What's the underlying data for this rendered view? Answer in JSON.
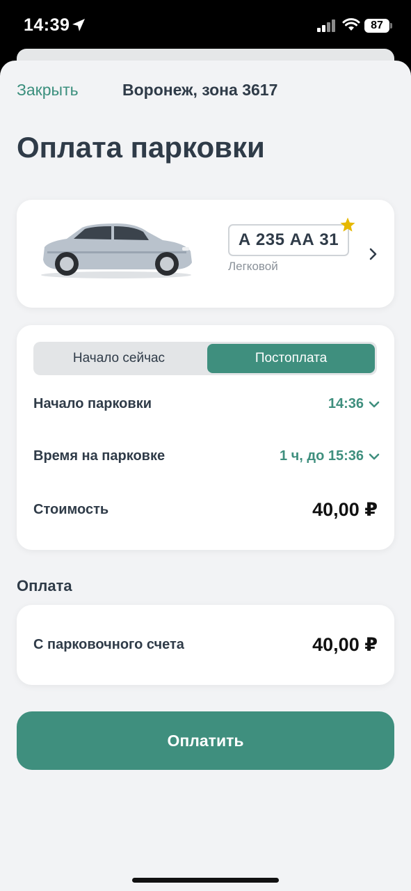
{
  "status_bar": {
    "time": "14:39",
    "battery": "87"
  },
  "header": {
    "close_label": "Закрыть",
    "zone": "Воронеж, зона 3617"
  },
  "page_title": "Оплата парковки",
  "vehicle": {
    "plate": "А 235 АА 31",
    "type": "Легковой",
    "favorite": true
  },
  "mode_tabs": [
    {
      "label": "Начало сейчас",
      "selected": false
    },
    {
      "label": "Постоплата",
      "selected": true
    }
  ],
  "parking": {
    "start_label": "Начало парковки",
    "start_value": "14:36",
    "duration_label": "Время на парковке",
    "duration_value": "1 ч, до 15:36",
    "cost_label": "Стоимость",
    "cost_value": "40,00 ₽"
  },
  "payment": {
    "section_title": "Оплата",
    "method_label": "С парковочного счета",
    "method_amount": "40,00 ₽"
  },
  "pay_button": "Оплатить",
  "colors": {
    "accent": "#3f8f7e",
    "background": "#f2f3f5",
    "text": "#2f3b48",
    "star": "#e6b800"
  }
}
